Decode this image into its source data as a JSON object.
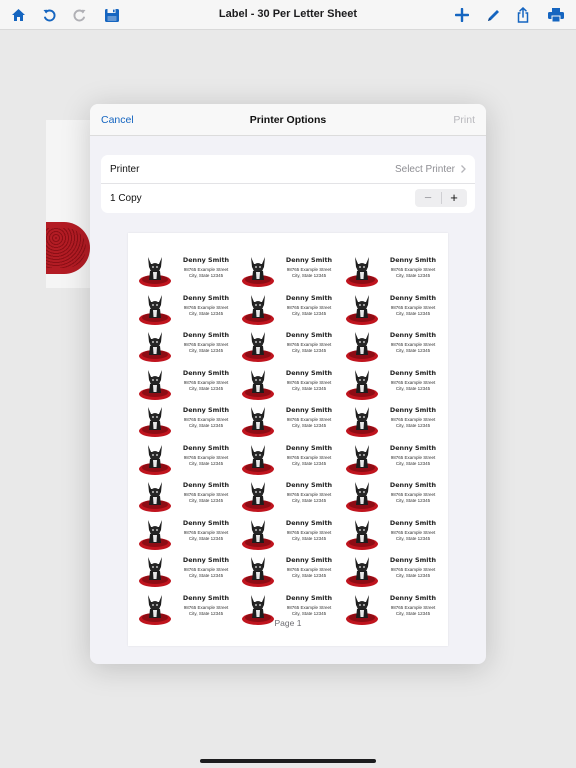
{
  "toolbar": {
    "title": "Label - 30 Per Letter Sheet",
    "icons": [
      "home-icon",
      "undo-icon",
      "redo-icon",
      "save-icon",
      "add-icon",
      "pen-icon",
      "share-icon",
      "print-icon"
    ],
    "accent": "#1565c0"
  },
  "dialog": {
    "title": "Printer Options",
    "cancel_label": "Cancel",
    "print_label": "Print",
    "printer_label": "Printer",
    "printer_value": "Select Printer",
    "copies_label": "1 Copy",
    "minus_symbol": "−",
    "plus_symbol": "+"
  },
  "preview": {
    "page_label": "Page 1",
    "label_name": "Denny Smith",
    "label_line1": "98765 Example Street",
    "label_line2": "City, State 12345",
    "rows": 10,
    "columns": 3
  }
}
